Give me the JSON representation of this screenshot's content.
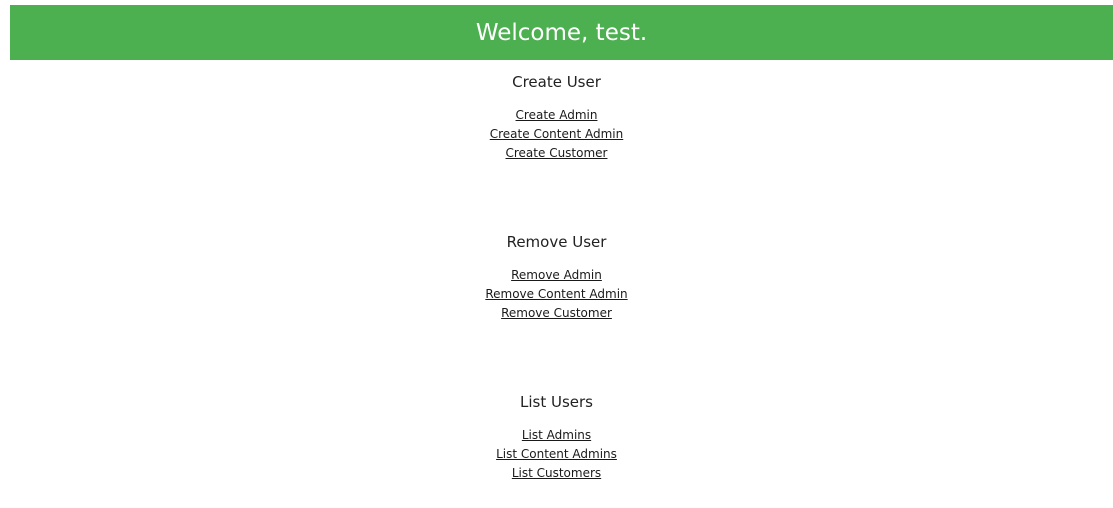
{
  "header": {
    "title": "Welcome, test."
  },
  "sections": [
    {
      "title": "Create User",
      "links": [
        "Create Admin",
        "Create Content Admin",
        "Create Customer"
      ]
    },
    {
      "title": "Remove User",
      "links": [
        "Remove Admin",
        "Remove Content Admin",
        "Remove Customer"
      ]
    },
    {
      "title": "List Users",
      "links": [
        "List Admins",
        "List Content Admins",
        "List Customers"
      ]
    }
  ],
  "colors": {
    "header_bg": "#4caf50",
    "header_text": "#ffffff"
  }
}
